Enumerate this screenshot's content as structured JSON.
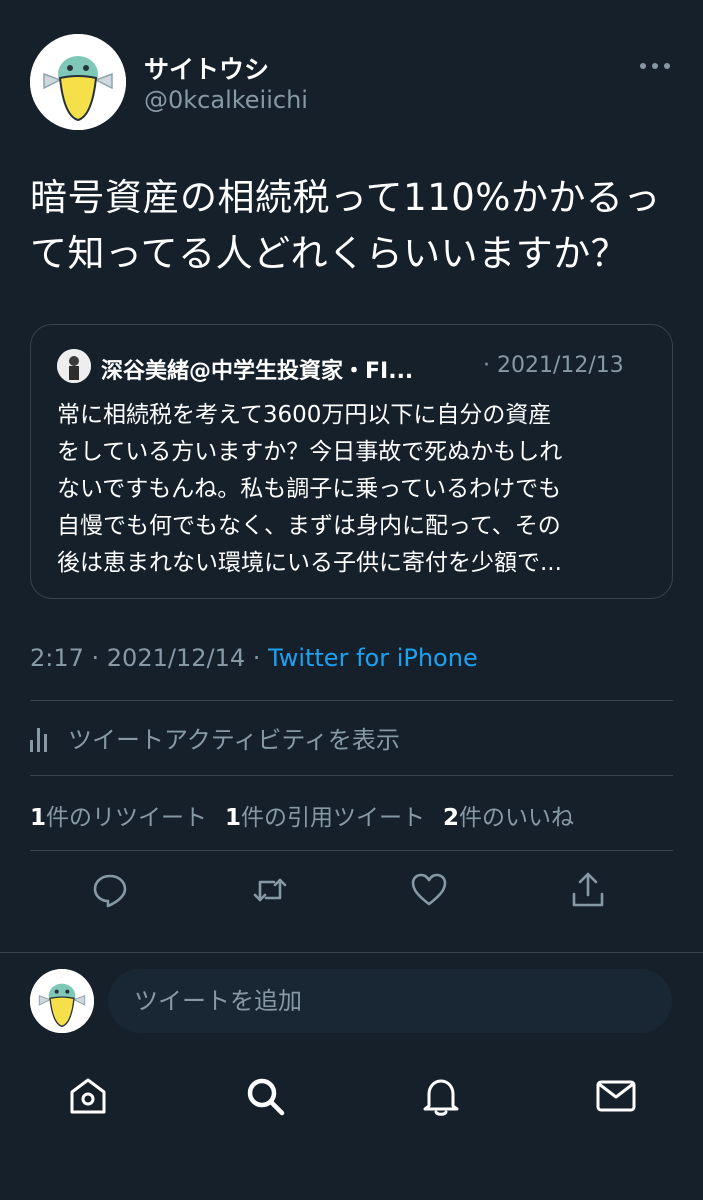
{
  "tweet": {
    "author": {
      "display_name": "サイトウシ",
      "handle": "@0kcalkeiichi"
    },
    "text": "暗号資産の相続税って110%かかるっ\nて知ってる人どれくらいいますか？",
    "quoted": {
      "author_name": "深谷美緒@中学生投資家・FI...",
      "date": "· 2021/12/13",
      "text": "常に相続税を考えて3600万円以下に自分の資産\nをしている方いますか？今日事故で死ぬかもしれ\nないですもんね。私も調子に乗っているわけでも\n自慢でも何でもなく、まずは身内に配って、その\n後は恵まれない環境にいる子供に寄付を少額で..."
    },
    "time": "2:17 · 2021/12/14 · ",
    "source": "Twitter for iPhone",
    "activity_label": "ツイートアクティビティを表示",
    "stats": {
      "retweets_count": "1",
      "retweets_label": "件のリツイート",
      "quotes_count": "1",
      "quotes_label": "件の引用ツイート",
      "likes_count": "2",
      "likes_label": "件のいいね"
    }
  },
  "reply": {
    "placeholder": "ツイートを追加"
  },
  "icons": {
    "more": "more-horizontal-icon",
    "reply": "reply-icon",
    "retweet": "retweet-icon",
    "like": "heart-icon",
    "share": "share-icon",
    "home": "home-icon",
    "search": "search-icon",
    "notifications": "bell-icon",
    "messages": "mail-icon"
  },
  "colors": {
    "background": "#15202b",
    "secondary_text": "#8899a6",
    "link": "#1da1f2",
    "border": "#38444d"
  }
}
